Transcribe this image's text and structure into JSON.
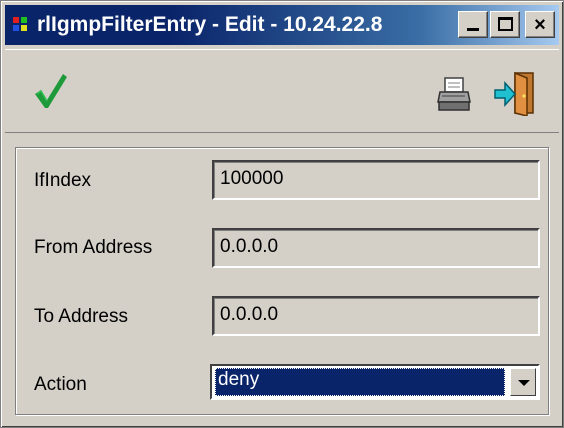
{
  "window": {
    "title": "rlIgmpFilterEntry -  Edit - 10.24.22.8",
    "buttons": {
      "minimize": "minimize-icon",
      "maximize": "maximize-icon",
      "close_glyph": "×"
    }
  },
  "toolbar": {
    "ok_icon": "checkmark-icon",
    "print_icon": "printer-icon",
    "exit_icon": "exit-door-icon"
  },
  "form": {
    "fields": [
      {
        "label": "IfIndex",
        "value": "100000"
      },
      {
        "label": "From Address",
        "value": "0.0.0.0"
      },
      {
        "label": "To Address",
        "value": "0.0.0.0"
      }
    ],
    "action": {
      "label": "Action",
      "value": "deny"
    }
  },
  "colors": {
    "title_bar": "#0a246a",
    "window_face": "#d4d0c8",
    "checkmark": "#1e9a3a",
    "selection": "#0a246a"
  }
}
